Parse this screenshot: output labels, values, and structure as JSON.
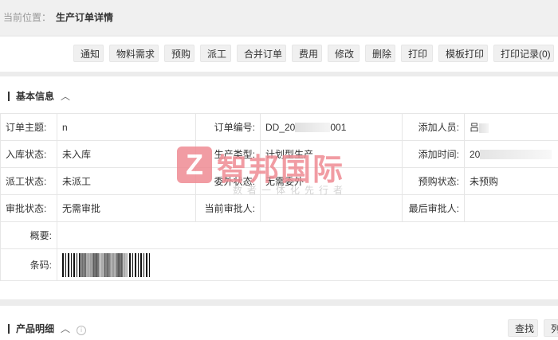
{
  "breadcrumb": {
    "prefix": "当前位置：",
    "current": "生产订单详情"
  },
  "toolbar": {
    "buttons": [
      "通知",
      "物料需求",
      "预购",
      "派工",
      "合并订单",
      "费用",
      "修改",
      "删除",
      "打印",
      "模板打印",
      "打印记录(0)"
    ]
  },
  "basic_info": {
    "title": "基本信息",
    "rows": [
      {
        "l1": "订单主题:",
        "v1": "n",
        "l2": "订单编号:",
        "v2a": "DD_20",
        "v2b": "001",
        "l3": "添加人员:",
        "v3": "吕"
      },
      {
        "l1": "入库状态:",
        "v1": "未入库",
        "l2": "生产类型:",
        "v2": "计划型生产",
        "l3": "添加时间:",
        "v3": "20"
      },
      {
        "l1": "派工状态:",
        "v1": "未派工",
        "l2": "委外状态:",
        "v2": "无需委外",
        "l3": "预购状态:",
        "v3": "未预购"
      },
      {
        "l1": "审批状态:",
        "v1": "无需审批",
        "l2": "当前审批人:",
        "v2": "",
        "l3": "最后审批人:",
        "v3": ""
      }
    ],
    "summary_label": "概要:",
    "barcode_label": "条码:"
  },
  "watermark": {
    "logo": "Z",
    "name": "智邦国际",
    "slogan": "数者一体化先行者"
  },
  "product_detail": {
    "title": "产品明细",
    "search_button": "查找",
    "cols_button": "列"
  }
}
